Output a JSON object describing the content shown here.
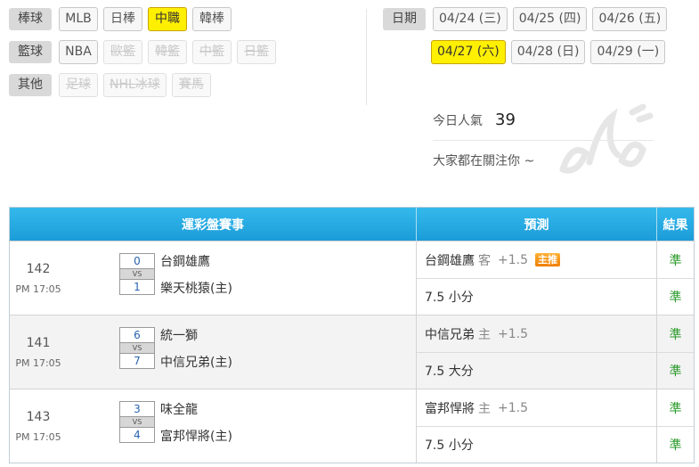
{
  "filters": [
    {
      "category": "棒球",
      "items": [
        {
          "label": "MLB",
          "state": "normal"
        },
        {
          "label": "日棒",
          "state": "normal"
        },
        {
          "label": "中職",
          "state": "active"
        },
        {
          "label": "韓棒",
          "state": "normal"
        }
      ]
    },
    {
      "category": "籃球",
      "items": [
        {
          "label": "NBA",
          "state": "normal"
        },
        {
          "label": "歐籃",
          "state": "disabled"
        },
        {
          "label": "韓籃",
          "state": "disabled"
        },
        {
          "label": "中籃",
          "state": "disabled"
        },
        {
          "label": "日籃",
          "state": "disabled"
        }
      ]
    },
    {
      "category": "其他",
      "items": [
        {
          "label": "足球",
          "state": "disabled"
        },
        {
          "label": "NHL冰球",
          "state": "disabled"
        },
        {
          "label": "賽馬",
          "state": "disabled"
        }
      ]
    }
  ],
  "dates": {
    "label": "日期",
    "row1": [
      "04/24 (三)",
      "04/25 (四)",
      "04/26 (五)"
    ],
    "row2": [
      "04/27 (六)",
      "04/28 (日)",
      "04/29 (一)"
    ],
    "active": "04/27 (六)"
  },
  "popularity": {
    "label": "今日人氣",
    "count": "39",
    "subtitle": "大家都在關注你 ~"
  },
  "table": {
    "headers": {
      "match": "運彩盤賽事",
      "prediction": "預測",
      "result": "結果"
    },
    "vs_label": "VS",
    "rows": [
      {
        "game_no": "142",
        "time": "PM 17:05",
        "away_score": "0",
        "home_score": "1",
        "away_team": "台鋼雄鷹",
        "home_team": "樂天桃猿(主)",
        "pred1": {
          "team": "台鋼雄鷹",
          "side": "客",
          "line": "+1.5",
          "badge": "主推"
        },
        "pred2": "7.5 小分",
        "results": [
          "準",
          "準"
        ]
      },
      {
        "game_no": "141",
        "time": "PM 17:05",
        "away_score": "6",
        "home_score": "7",
        "away_team": "統一獅",
        "home_team": "中信兄弟(主)",
        "pred1": {
          "team": "中信兄弟",
          "side": "主",
          "line": "+1.5",
          "badge": ""
        },
        "pred2": "7.5 大分",
        "results": [
          "準",
          "準"
        ]
      },
      {
        "game_no": "143",
        "time": "PM 17:05",
        "away_score": "3",
        "home_score": "4",
        "away_team": "味全龍",
        "home_team": "富邦悍將(主)",
        "pred1": {
          "team": "富邦悍將",
          "side": "主",
          "line": "+1.5",
          "badge": ""
        },
        "pred2": "7.5 小分",
        "results": [
          "準",
          "準"
        ]
      }
    ]
  },
  "colors": {
    "accent_yellow": "#ffef00",
    "header_blue": "#1c9cd8",
    "result_green": "#2a9a2a",
    "badge_orange": "#f07d00"
  }
}
